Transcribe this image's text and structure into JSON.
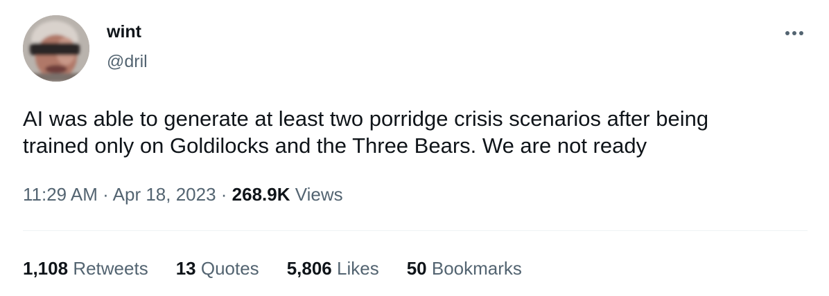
{
  "author": {
    "display_name": "wint",
    "handle": "@dril"
  },
  "icons": {
    "more": "more-horizontal-icon"
  },
  "tweet": {
    "text": "AI was able to generate at least two porridge crisis scenarios after being\ntrained only on Goldilocks and the Three Bears. We are not ready"
  },
  "meta": {
    "time": "11:29 AM",
    "separator": "·",
    "date": "Apr 18, 2023",
    "views_count": "268.9K",
    "views_label": "Views"
  },
  "stats": {
    "retweets": {
      "count": "1,108",
      "label": "Retweets"
    },
    "quotes": {
      "count": "13",
      "label": "Quotes"
    },
    "likes": {
      "count": "5,806",
      "label": "Likes"
    },
    "bookmarks": {
      "count": "50",
      "label": "Bookmarks"
    }
  },
  "colors": {
    "text_primary": "#0f1419",
    "text_secondary": "#536471",
    "divider": "#eff3f4"
  }
}
